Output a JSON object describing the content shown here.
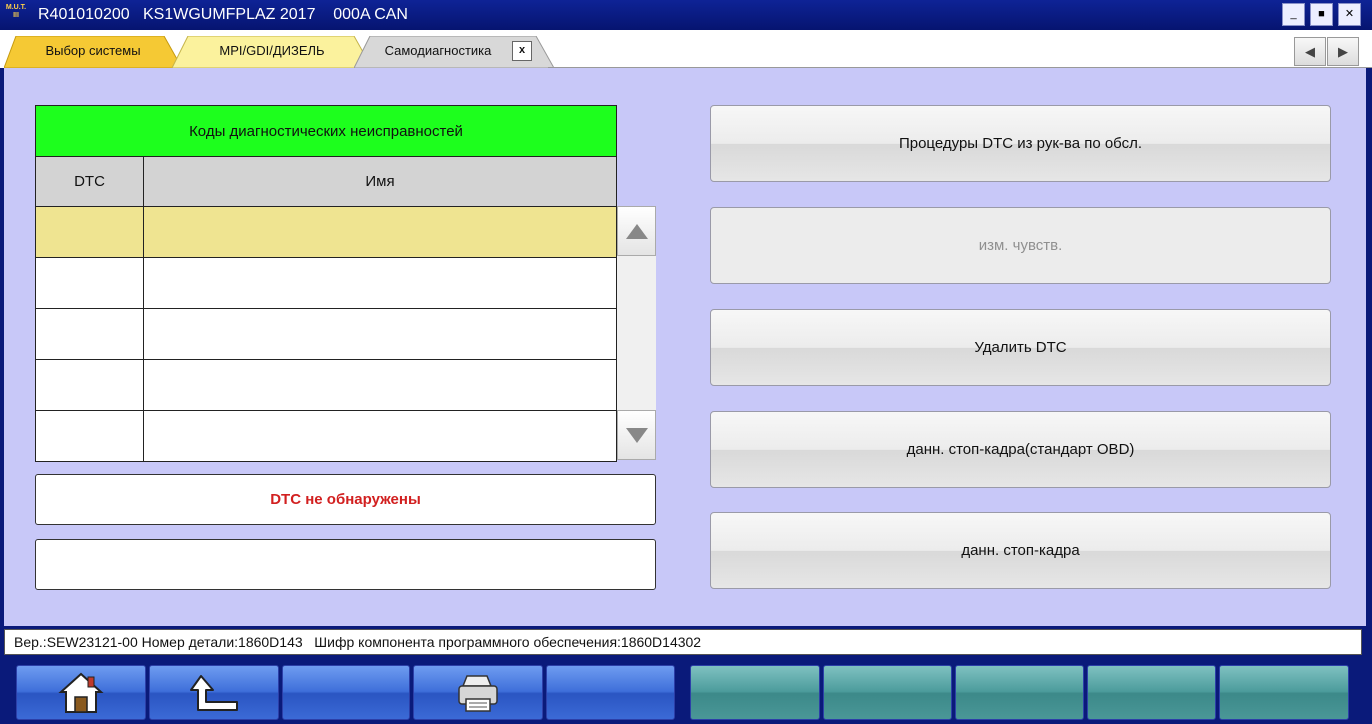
{
  "window": {
    "logo_text": "M.U.T.\nIII",
    "title": "R401010200   KS1WGUMFPLAZ 2017    000A CAN",
    "minimize_label": "_",
    "maximize_label": "■",
    "close_label": "✕"
  },
  "tabs": [
    {
      "label": "Выбор системы"
    },
    {
      "label": "MPI/GDI/ДИЗЕЛЬ"
    },
    {
      "label": "Самодиагностика",
      "close_label": "x"
    }
  ],
  "tab_nav": {
    "prev": "◀",
    "next": "▶"
  },
  "dtc_table": {
    "title": "Коды диагностических  неисправностей",
    "col_dtc": "DTC",
    "col_name": "Имя",
    "rows": [
      {
        "dtc": "",
        "name": ""
      },
      {
        "dtc": "",
        "name": ""
      },
      {
        "dtc": "",
        "name": ""
      },
      {
        "dtc": "",
        "name": ""
      },
      {
        "dtc": "",
        "name": ""
      }
    ]
  },
  "message": "DTC не обнаружены",
  "message2": "",
  "actions": [
    {
      "label": "Процедуры DTC из рук-ва по обсл.",
      "enabled": true
    },
    {
      "label": "изм. чувств.",
      "enabled": false
    },
    {
      "label": "Удалить DTC",
      "enabled": true
    },
    {
      "label": "данн. стоп-кадра(стандарт OBD)",
      "enabled": true
    },
    {
      "label": "данн. стоп-кадра",
      "enabled": true
    }
  ],
  "status": "Вер.:SEW23121-00 Номер детали:1860D143   Шифр компонента программного обеспечения:1860D14302",
  "toolbar": {
    "icons": [
      "home-icon",
      "back-arrow-icon",
      "",
      "printer-icon",
      ""
    ]
  },
  "colors": {
    "table_header": "#1dff1d",
    "selected_row": "#efe491",
    "panel_bg": "#c8c8f8",
    "message_text": "#d22020"
  }
}
